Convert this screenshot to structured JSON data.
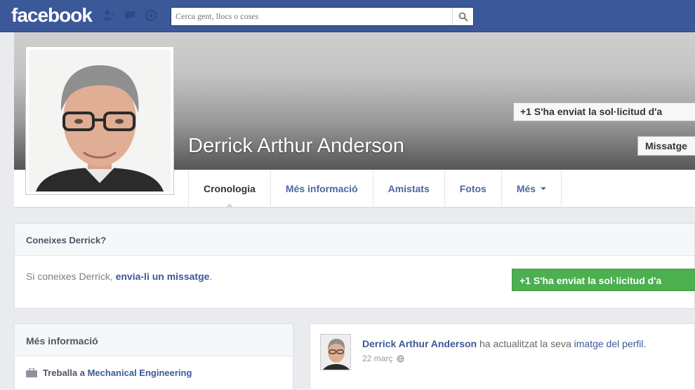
{
  "topbar": {
    "logo": "facebook",
    "search_placeholder": "Cerca gent, llocs o coses",
    "icons": [
      "friend-requests-icon",
      "messages-icon",
      "notifications-icon",
      "search-icon"
    ]
  },
  "profile": {
    "name": "Derrick Arthur Anderson",
    "friend_request_button": "+1 S'ha enviat la sol·licitud d'a",
    "message_button": "Missatge"
  },
  "tabs": [
    {
      "label": "Cronologia",
      "active": true
    },
    {
      "label": "Més informació",
      "active": false
    },
    {
      "label": "Amistats",
      "active": false
    },
    {
      "label": "Fotos",
      "active": false
    },
    {
      "label": "Més",
      "active": false
    }
  ],
  "know_box": {
    "title": "Coneixes Derrick?",
    "text_prefix": "Si coneixes Derrick, ",
    "link": "envia-li un missatge",
    "text_suffix": ".",
    "button": "+1 S'ha enviat la sol·licitud d'a"
  },
  "info_box": {
    "title": "Més informació",
    "work_prefix": "Treballa a ",
    "work_link": "Mechanical Engineering"
  },
  "post": {
    "author": "Derrick Arthur Anderson",
    "action": " ha actualitzat la seva ",
    "link": "imatge del perfil.",
    "date": "22 març"
  },
  "colors": {
    "brand": "#3b5998",
    "green": "#4caf50"
  }
}
